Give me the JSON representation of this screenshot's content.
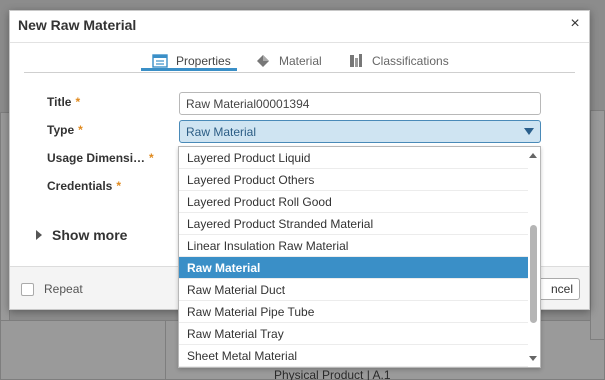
{
  "dialog": {
    "title": "New Raw Material",
    "close_glyph": "×"
  },
  "tabs": [
    {
      "label": "Properties",
      "icon": "properties-icon",
      "active": true
    },
    {
      "label": "Material",
      "icon": "material-icon",
      "active": false
    },
    {
      "label": "Classifications",
      "icon": "classifications-icon",
      "active": false
    }
  ],
  "form": {
    "title_label": "Title",
    "title_value": "Raw Material00001394",
    "type_label": "Type",
    "type_value": "Raw Material",
    "usage_label": "Usage Dimensi…",
    "credentials_label": "Credentials",
    "required_mark": "*",
    "show_more": "Show more"
  },
  "footer": {
    "repeat_label": "Repeat",
    "cancel_label": "ncel"
  },
  "dropdown": {
    "options": [
      "Layered Product Liquid",
      "Layered Product Others",
      "Layered Product Roll Good",
      "Layered Product Stranded Material",
      "Linear Insulation Raw Material",
      "Raw Material",
      "Raw Material Duct",
      "Raw Material Pipe Tube",
      "Raw Material Tray",
      "Sheet Metal Material"
    ],
    "selected_index": 5
  },
  "background": {
    "partial_text": "Physical Product | A.1"
  },
  "colors": {
    "accent": "#3a8fc7",
    "required": "#e08a1e",
    "select_bg": "#cfe4f2"
  }
}
